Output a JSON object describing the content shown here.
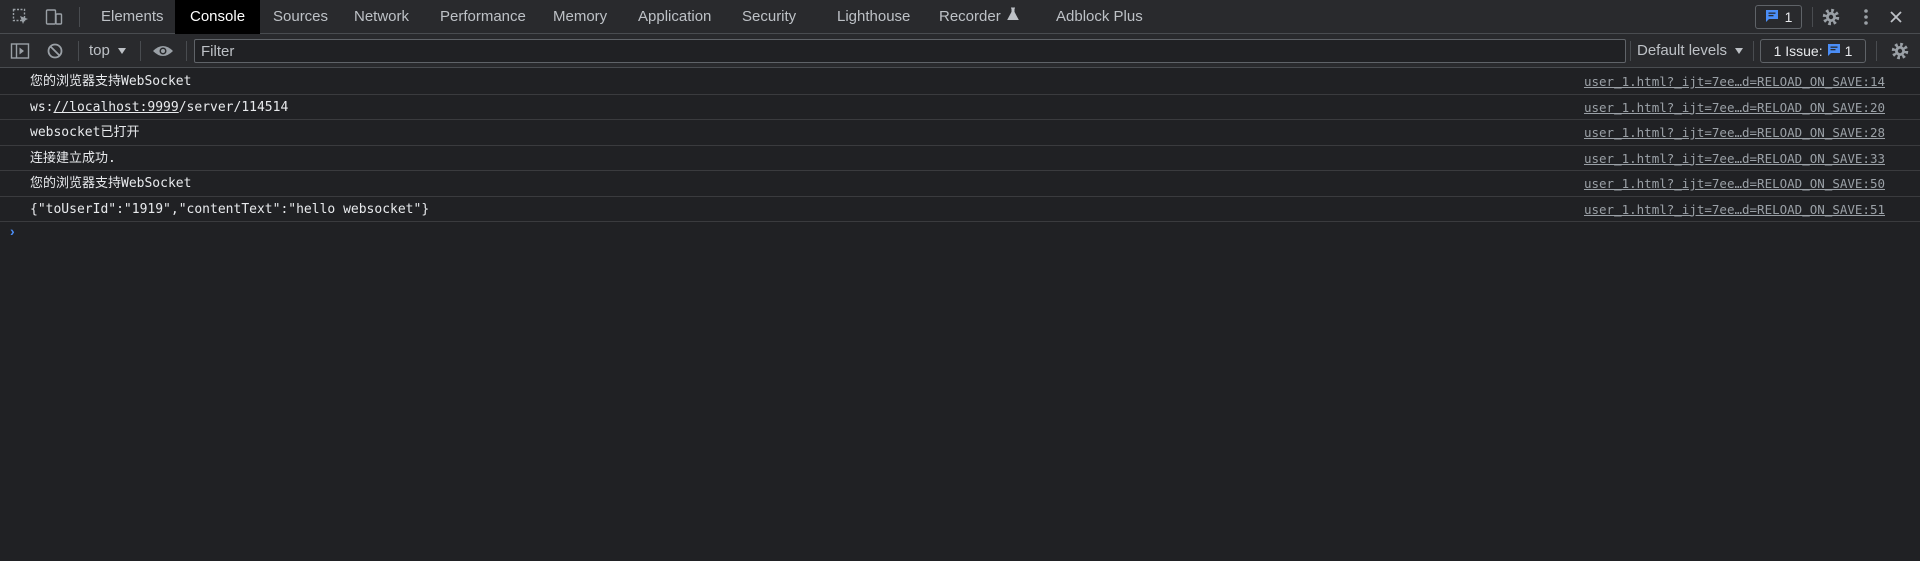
{
  "tabs": [
    {
      "label": "Elements",
      "active": false
    },
    {
      "label": "Console",
      "active": true
    },
    {
      "label": "Sources",
      "active": false
    },
    {
      "label": "Network",
      "active": false
    },
    {
      "label": "Performance",
      "active": false
    },
    {
      "label": "Memory",
      "active": false
    },
    {
      "label": "Application",
      "active": false
    },
    {
      "label": "Security",
      "active": false
    },
    {
      "label": "Lighthouse",
      "active": false
    },
    {
      "label": "Recorder",
      "active": false
    },
    {
      "label": "Adblock Plus",
      "active": false
    }
  ],
  "header_right": {
    "messages_count": "1"
  },
  "toolbar": {
    "context": "top",
    "filter_placeholder": "Filter",
    "levels": "Default levels",
    "issues_label": "1 Issue:",
    "issues_count": "1"
  },
  "messages": [
    {
      "pre": "您的浏览器支持WebSocket",
      "link": "",
      "post": "",
      "source": "user_1.html?_ijt=7ee…d=RELOAD_ON_SAVE:14"
    },
    {
      "pre": "ws:",
      "link": "//localhost:9999",
      "post": "/server/114514",
      "source": "user_1.html?_ijt=7ee…d=RELOAD_ON_SAVE:20"
    },
    {
      "pre": "websocket已打开",
      "link": "",
      "post": "",
      "source": "user_1.html?_ijt=7ee…d=RELOAD_ON_SAVE:28"
    },
    {
      "pre": "连接建立成功.",
      "link": "",
      "post": "",
      "source": "user_1.html?_ijt=7ee…d=RELOAD_ON_SAVE:33"
    },
    {
      "pre": "您的浏览器支持WebSocket",
      "link": "",
      "post": "",
      "source": "user_1.html?_ijt=7ee…d=RELOAD_ON_SAVE:50"
    },
    {
      "pre": "{\"toUserId\":\"1919\",\"contentText\":\"hello websocket\"}",
      "link": "",
      "post": "",
      "source": "user_1.html?_ijt=7ee…d=RELOAD_ON_SAVE:51"
    }
  ],
  "prompt_symbol": "›",
  "colors": {
    "background": "#202124",
    "toolbar": "#292a2d",
    "active_tab": "#000000",
    "accent": "#4b8ef7"
  }
}
